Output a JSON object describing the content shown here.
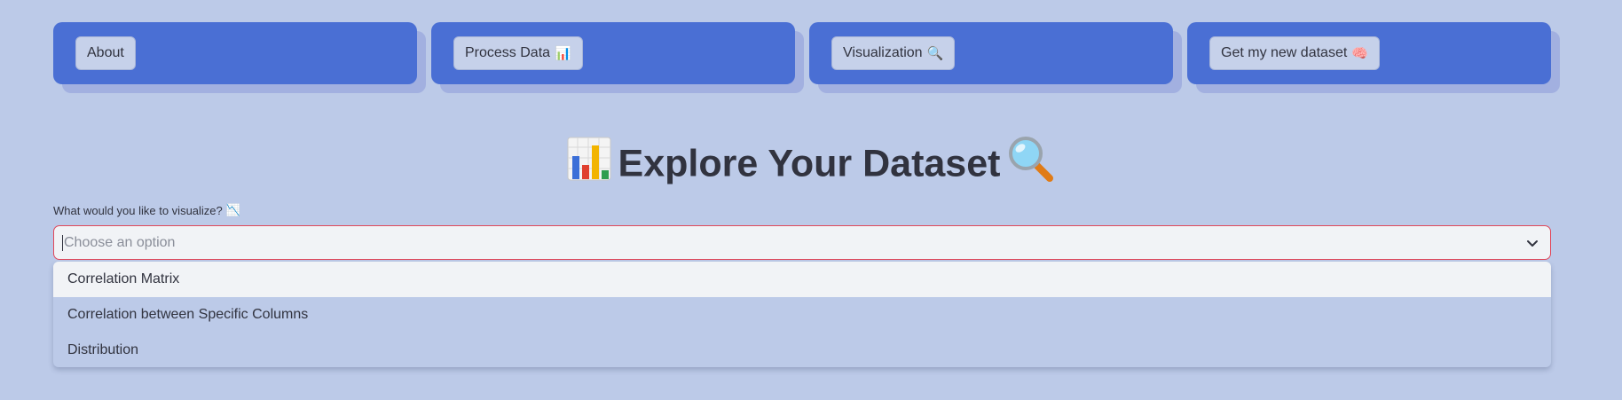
{
  "nav": {
    "buttons": [
      {
        "label": "About",
        "icon": ""
      },
      {
        "label": "Process Data",
        "icon": "📊"
      },
      {
        "label": "Visualization",
        "icon": "🔍"
      },
      {
        "label": "Get my new dataset",
        "icon": "🧠"
      }
    ]
  },
  "page": {
    "title": "Explore Your Dataset",
    "title_icon_left": "bar-chart-icon",
    "title_icon_right": "magnifier-icon"
  },
  "select": {
    "label": "What would you like to visualize?",
    "label_icon": "📉",
    "placeholder": "Choose an option",
    "options": [
      "Correlation Matrix",
      "Correlation between Specific Columns",
      "Distribution"
    ]
  },
  "colors": {
    "background": "#bccae8",
    "nav_card": "#4a6fd4",
    "accent_border": "#e0475a",
    "text": "#31333f"
  }
}
